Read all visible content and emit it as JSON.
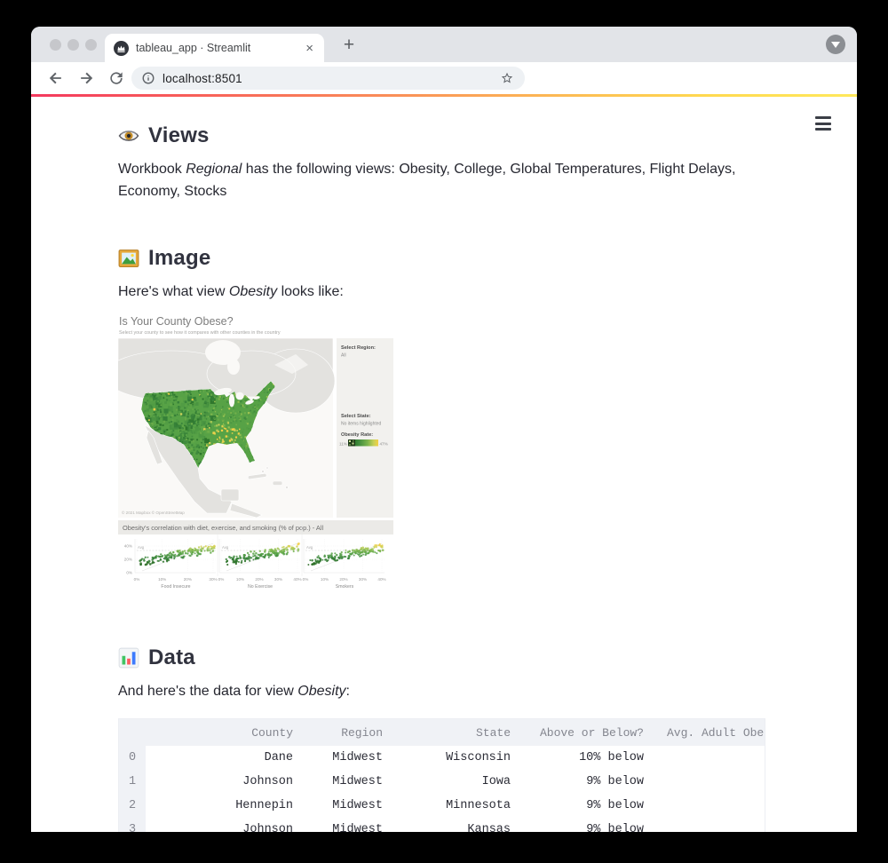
{
  "browser": {
    "tab": {
      "title": "tableau_app · Streamlit",
      "close": "×",
      "new_tab": "+"
    },
    "address": {
      "url": "localhost:8501"
    }
  },
  "menu": {
    "icon": "hamburger"
  },
  "sections": {
    "views": {
      "heading": "Views",
      "paragraph": {
        "pre": "Workbook ",
        "em": "Regional",
        "post": " has the following views: Obesity, College, Global Temperatures, Flight Delays, Economy, Stocks"
      }
    },
    "image": {
      "heading": "Image",
      "caption": {
        "pre": "Here's what view ",
        "em": "Obesity",
        "post": " looks like:"
      }
    },
    "data": {
      "heading": "Data",
      "caption": {
        "pre": "And here's the data for view ",
        "em": "Obesity",
        "post": ":"
      }
    }
  },
  "viz": {
    "title": "Is Your County Obese?",
    "subtitle": "Select your county to see how it compares with other counties in the country",
    "attribution": "© 2021 Mapbox © OpenStreetMap",
    "region_label": "Select Region:",
    "region_value": "All",
    "state_label": "Select State:",
    "state_value": "No items highlighted",
    "legend_label": "Obesity Rate:",
    "legend_min": "11%",
    "legend_max": "47%",
    "strip_title": "Obesity's correlation with diet, exercise, and smoking (% of pop.) - All",
    "avg_label": "Avg",
    "yticks": [
      "40%",
      "20%",
      "0%"
    ],
    "panels": [
      {
        "label": "Food Insecure",
        "xticks": [
          "0%",
          "10%",
          "20%",
          "30%"
        ]
      },
      {
        "label": "No Exercise",
        "xticks": [
          "0%",
          "10%",
          "20%",
          "30%",
          "40%"
        ]
      },
      {
        "label": "Smokers",
        "xticks": [
          "0%",
          "10%",
          "20%",
          "30%",
          "40%"
        ]
      }
    ],
    "palette": [
      "#24691d",
      "#37823a",
      "#57a246",
      "#8abc4f",
      "#cbd25b",
      "#f3cf45"
    ]
  },
  "table": {
    "columns": [
      "",
      "County",
      "Region",
      "State",
      "Above or Below?",
      "Avg. Adult Obesi"
    ],
    "rows": [
      [
        "0",
        "Dane",
        "Midwest",
        "Wisconsin",
        "10% below",
        ""
      ],
      [
        "1",
        "Johnson",
        "Midwest",
        "Iowa",
        "9% below",
        ""
      ],
      [
        "2",
        "Hennepin",
        "Midwest",
        "Minnesota",
        "9% below",
        ""
      ],
      [
        "3",
        "Johnson",
        "Midwest",
        "Kansas",
        "9% below",
        ""
      ]
    ]
  }
}
